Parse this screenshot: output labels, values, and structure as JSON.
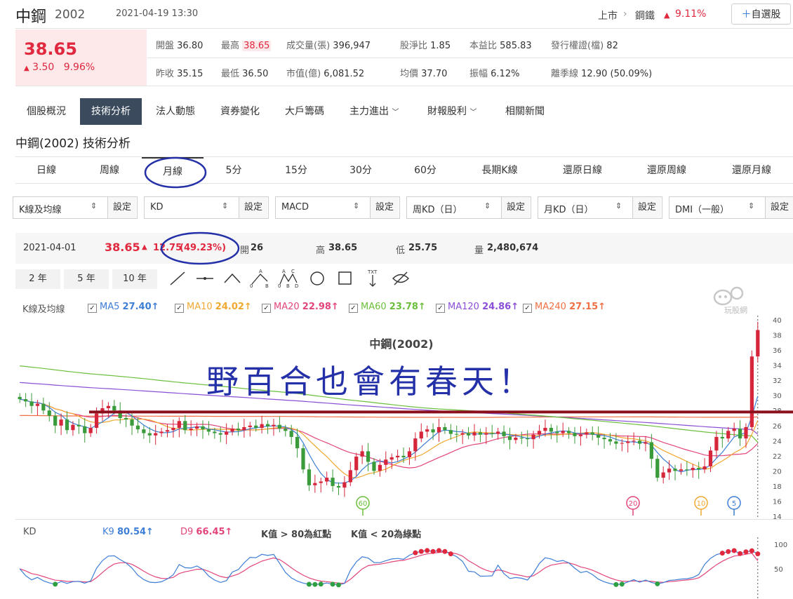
{
  "header": {
    "name": "中鋼",
    "code": "2002",
    "datetime": "2021-04-19 13:30",
    "market": "上市",
    "industry": "鋼鐵",
    "industry_change": "9.11%",
    "watch_button": "自選股"
  },
  "quote": {
    "price": "38.65",
    "change": "3.50",
    "change_pct": "9.96%",
    "stats": [
      {
        "label": "開盤",
        "value": "36.80"
      },
      {
        "label": "最高",
        "value": "38.65"
      },
      {
        "label": "成交量(張)",
        "value": "396,947"
      },
      {
        "label": "股淨比",
        "value": "1.85"
      },
      {
        "label": "本益比",
        "value": "585.83"
      },
      {
        "label": "發行權證(檔)",
        "value": "82"
      },
      {
        "label": "昨收",
        "value": "35.15"
      },
      {
        "label": "最低",
        "value": "36.50"
      },
      {
        "label": "市值(億)",
        "value": "6,081.52"
      },
      {
        "label": "均價",
        "value": "37.70"
      },
      {
        "label": "振幅",
        "value": "6.12%"
      },
      {
        "label": "離季線",
        "value": "12.90 (50.09%)"
      }
    ]
  },
  "tabs": [
    "個股概況",
    "技術分析",
    "法人動態",
    "資券變化",
    "大戶籌碼",
    "主力進出",
    "財報股利",
    "相關新聞"
  ],
  "section_title": "中鋼(2002) 技術分析",
  "periods": [
    "日線",
    "周線",
    "月線",
    "5分",
    "15分",
    "30分",
    "60分",
    "長期K線",
    "還原日線",
    "還原周線",
    "還原月線"
  ],
  "selectors": [
    {
      "label": "K線及均線",
      "btn": "設定"
    },
    {
      "label": "KD",
      "btn": "設定"
    },
    {
      "label": "MACD",
      "btn": "設定"
    },
    {
      "label": "周KD（日）",
      "btn": "設定"
    },
    {
      "label": "月KD（日）",
      "btn": "設定"
    },
    {
      "label": "DMI（一般）",
      "btn": "設定"
    }
  ],
  "info": {
    "date": "2021-04-01",
    "price": "38.65",
    "change": "12.75",
    "change_pct": "(49.23%)",
    "open_label": "開",
    "open": "26",
    "high_label": "高",
    "high": "38.65",
    "low_label": "低",
    "low": "25.75",
    "vol_label": "量",
    "vol": "2,480,674"
  },
  "ranges": [
    "2 年",
    "5 年",
    "10 年"
  ],
  "ma_legend": {
    "title": "K線及均線",
    "items": [
      {
        "name": "MA5",
        "value": "27.40↑",
        "color": "#3d7ed6"
      },
      {
        "name": "MA10",
        "value": "24.02↑",
        "color": "#f0a830"
      },
      {
        "name": "MA20",
        "value": "22.98↑",
        "color": "#e2457c"
      },
      {
        "name": "MA60",
        "value": "23.78↑",
        "color": "#6bbf3b"
      },
      {
        "name": "MA120",
        "value": "24.86↑",
        "color": "#8a4fd6"
      },
      {
        "name": "MA240",
        "value": "27.15↑",
        "color": "#ef6f43"
      }
    ]
  },
  "watermark": "玩股網",
  "chart_data": [
    {
      "type": "candlestick",
      "title": "中鋼(2002)",
      "annotation": "野百合也會有春天！",
      "ylim": [
        14,
        40
      ],
      "y_ticks": [
        "40",
        "38",
        "36",
        "34",
        "32",
        "30",
        "28",
        "26",
        "24",
        "22",
        "20",
        "18",
        "16",
        "14"
      ],
      "reference_line": 27.8,
      "ma_markers": [
        "60",
        "20",
        "10",
        "5"
      ],
      "closes": [
        29.5,
        29.2,
        28.6,
        28.9,
        28.0,
        27.3,
        26.0,
        26.8,
        25.4,
        26.1,
        25.9,
        25.0,
        25.7,
        27.6,
        28.3,
        28.6,
        28.0,
        27.0,
        26.8,
        26.0,
        25.5,
        25.0,
        24.7,
        25.0,
        25.2,
        25.4,
        25.7,
        26.6,
        25.4,
        25.6,
        25.9,
        25.5,
        25.2,
        25.0,
        24.8,
        25.2,
        25.6,
        25.4,
        25.8,
        26.0,
        25.7,
        26.2,
        25.9,
        26.1,
        25.6,
        25.3,
        24.5,
        23.0,
        20.2,
        18.1,
        18.4,
        18.6,
        19.1,
        18.0,
        17.8,
        18.5,
        20.1,
        21.9,
        22.6,
        21.2,
        20.0,
        20.8,
        21.5,
        21.8,
        22.0,
        21.8,
        22.6,
        24.3,
        25.2,
        25.5,
        25.1,
        25.8,
        25.4,
        24.9,
        24.8,
        25.0,
        24.7,
        25.1,
        24.8,
        25.0,
        24.9,
        25.2,
        24.6,
        24.1,
        24.4,
        24.3,
        24.2,
        24.8,
        25.3,
        25.7,
        25.2,
        25.0,
        25.3,
        25.0,
        24.6,
        24.8,
        25.1,
        24.8,
        24.4,
        24.2,
        23.9,
        23.6,
        23.7,
        23.9,
        24.0,
        23.6,
        23.8,
        21.6,
        19.1,
        19.8,
        20.3,
        20.0,
        20.2,
        20.1,
        20.4,
        20.2,
        20.6,
        22.7,
        24.5,
        24.3,
        25.3,
        25.6,
        24.3,
        25.8,
        35.15,
        38.65
      ]
    },
    {
      "type": "line",
      "title": "KD",
      "series": [
        {
          "name": "K9",
          "value": "80.54↑",
          "color": "#3d7ed6"
        },
        {
          "name": "D9",
          "value": "66.45↑",
          "color": "#e2457c"
        }
      ],
      "notes": [
        "K值 > 80為紅點",
        "K值 < 20為綠點"
      ],
      "ylim": [
        0,
        100
      ],
      "y_ticks": [
        "100",
        "50"
      ]
    }
  ]
}
